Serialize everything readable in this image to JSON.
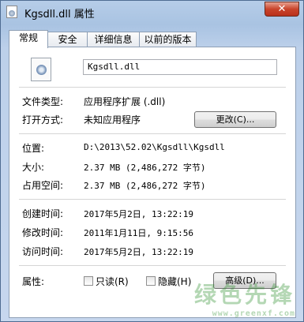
{
  "window": {
    "title": "Kgsdll.dll 属性",
    "close_label": "✕"
  },
  "tabs": [
    "常规",
    "安全",
    "详细信息",
    "以前的版本"
  ],
  "file": {
    "name": "Kgsdll.dll"
  },
  "type": {
    "label": "文件类型:",
    "value": "应用程序扩展 (.dll)"
  },
  "opens_with": {
    "label": "打开方式:",
    "value": "未知应用程序",
    "button": "更改(C)..."
  },
  "location": {
    "label": "位置:",
    "value": "D:\\2013\\52.02\\Kgsdll\\Kgsdll"
  },
  "size": {
    "label": "大小:",
    "value": "2.37 MB (2,486,272 字节)"
  },
  "size_on_disk": {
    "label": "占用空间:",
    "value": "2.37 MB (2,486,272 字节)"
  },
  "created": {
    "label": "创建时间:",
    "value": "2017年5月2日, 13:22:19"
  },
  "modified": {
    "label": "修改时间:",
    "value": "2011年1月11日, 9:15:56"
  },
  "accessed": {
    "label": "访问时间:",
    "value": "2017年5月2日, 13:22:19"
  },
  "attributes": {
    "label": "属性:",
    "readonly": "只读(R)",
    "hidden": "隐藏(H)",
    "advanced_button": "高级(D)..."
  },
  "watermark": {
    "line1": "绿色先锋",
    "line2": "www.greenxf.com"
  },
  "colors": {
    "window_frame": "#a9c3e2",
    "close_button": "#c9442b",
    "background": "#6fbf57"
  }
}
